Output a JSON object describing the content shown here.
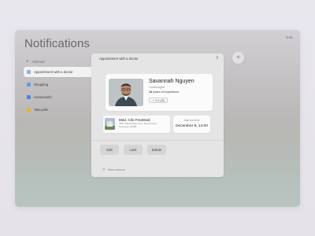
{
  "app": {
    "title": "Notifications",
    "clock": "9:41"
  },
  "sidebar": {
    "add_new": "Add new",
    "items": [
      {
        "label": "Appointment with a doctor",
        "icon": "doctor-icon",
        "color": "#8fb4e8",
        "active": true
      },
      {
        "label": "Shopping",
        "icon": "shopping-icon",
        "color": "#5aa0e0",
        "active": false
      },
      {
        "label": "Homeworks",
        "icon": "homework-icon",
        "color": "#4a86d0",
        "active": false
      },
      {
        "label": "Take pills",
        "icon": "pills-icon",
        "color": "#e2b23c",
        "active": false
      }
    ]
  },
  "detail": {
    "header": "Appointment with a doctor",
    "doctor": {
      "name": "Savannah Nguyen",
      "specialty": "Cardiologist",
      "experience_years": "13",
      "experience_text": "years of experience",
      "rating": "4.6 (35)"
    },
    "clinic": {
      "name": "Med. Clin FreeDeal",
      "address": "4517 Washington Ave. Manchester, Kentucky 39495"
    },
    "date": {
      "label": "Date and time",
      "value": "December 9, 14:00"
    },
    "actions": [
      "Edit",
      "Lock",
      "Delete"
    ],
    "more_actions": "More actions"
  },
  "colors": {
    "accent_blue": "#5aa0e0",
    "star": "#b9b7b8"
  }
}
